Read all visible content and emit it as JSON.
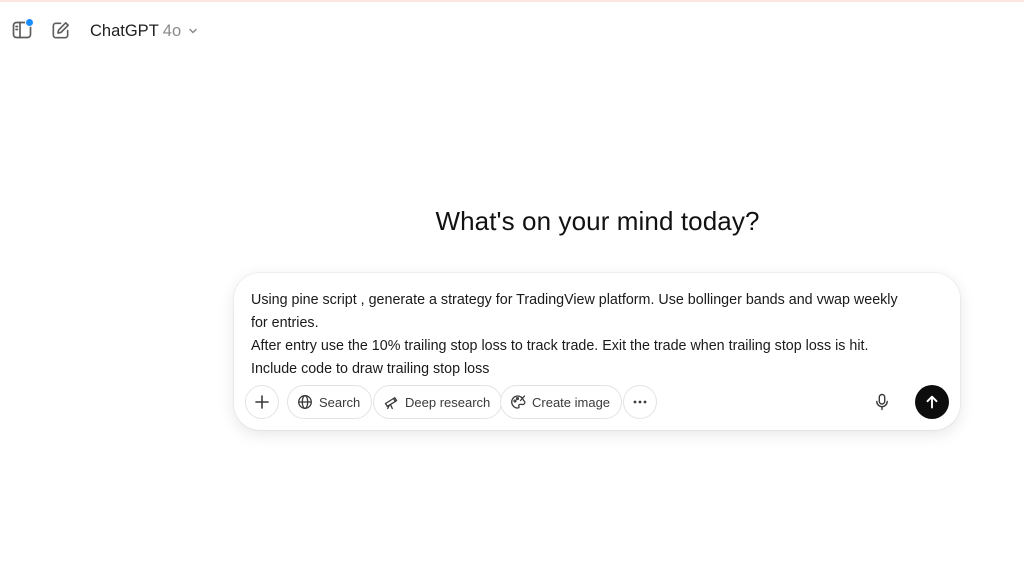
{
  "header": {
    "sidebar_icon": "sidebar-toggle-icon",
    "new_chat_icon": "new-chat-icon",
    "model_name": "ChatGPT",
    "model_version": "4o",
    "chevron_icon": "chevron-down-icon",
    "notification_dot_color": "#1a8cff"
  },
  "main": {
    "heading": "What's on your mind today?"
  },
  "composer": {
    "prompt_lines": [
      "Using pine script , generate a strategy for TradingView platform. Use bollinger bands and vwap weekly",
      "for entries.",
      "After entry use the 10% trailing stop loss to track trade. Exit the trade when trailing stop loss is hit.",
      "Include code to draw trailing stop loss"
    ],
    "tools": {
      "add_icon": "plus-icon",
      "search_label": "Search",
      "search_icon": "globe-icon",
      "deep_research_label": "Deep research",
      "deep_research_icon": "telescope-icon",
      "create_image_label": "Create image",
      "create_image_icon": "palette-icon",
      "more_icon": "more-dots-icon"
    },
    "mic_icon": "microphone-icon",
    "send_icon": "arrow-up-icon",
    "send_button_color": "#0d0d0d"
  }
}
